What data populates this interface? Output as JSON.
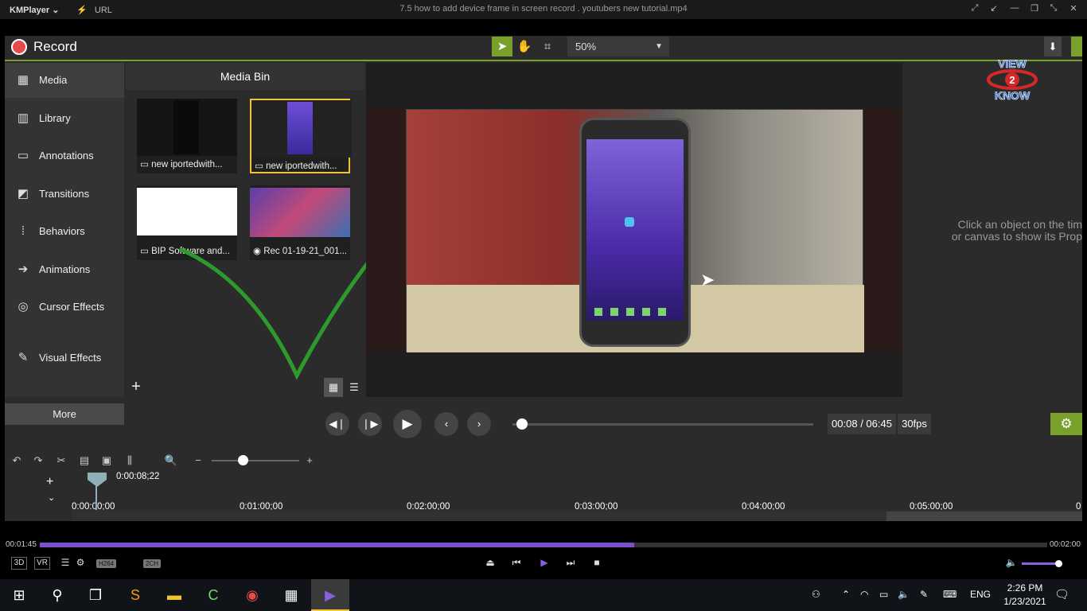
{
  "kmplayer": {
    "logo": "KMPlayer",
    "logo_dropdown": "⌄",
    "url_label": "URL",
    "window_title": "7.5 how to add device frame in screen record . youtubers new tutorial.mp4",
    "controls": [
      "pin-icon",
      "shrink-icon",
      "minimize-icon",
      "restore-icon",
      "fullscreen-icon",
      "close-icon"
    ],
    "elapsed": "00:01:45",
    "total": "00:02:00",
    "progress": 0.59,
    "volume": 0.92,
    "tags": [
      "H264",
      "2CH"
    ],
    "left_tools": [
      "3D",
      "VR"
    ]
  },
  "camtasia": {
    "record_label": "Record",
    "zoom_value": "50%",
    "nav": [
      {
        "label": "Media",
        "icon": "media-icon"
      },
      {
        "label": "Library",
        "icon": "library-icon"
      },
      {
        "label": "Annotations",
        "icon": "annotations-icon"
      },
      {
        "label": "Transitions",
        "icon": "transitions-icon"
      },
      {
        "label": "Behaviors",
        "icon": "behaviors-icon"
      },
      {
        "label": "Animations",
        "icon": "animations-icon"
      },
      {
        "label": "Cursor Effects",
        "icon": "cursor-effects-icon"
      },
      {
        "label": "Visual Effects",
        "icon": "visual-effects-icon"
      }
    ],
    "more_label": "More",
    "media_bin": {
      "title": "Media Bin",
      "items": [
        {
          "caption": "new iportedwith...",
          "kind": "video"
        },
        {
          "caption": "new iportedwith...",
          "kind": "video"
        },
        {
          "caption": "BIP Software and...",
          "kind": "video"
        },
        {
          "caption": "Rec 01-19-21_001...",
          "kind": "recording"
        }
      ]
    },
    "properties_hint_1": "Click an object on the tim",
    "properties_hint_2": "or canvas to show its Prop",
    "time_display": "00:08 / 06:45",
    "fps": "30fps",
    "playhead_time": "0:00:08;22",
    "ruler_ticks": [
      "0:00:00;00",
      "0:01:00;00",
      "0:02:00;00",
      "0:03:00;00",
      "0:04:00;00",
      "0:05:00;00",
      "0"
    ]
  },
  "watermark": {
    "line1": "VIEW",
    "digit": "2",
    "line2": "KNOW"
  },
  "taskbar": {
    "time": "2:26 PM",
    "date": "1/23/2021",
    "language": "ENG"
  },
  "colors": {
    "accent_green": "#7aa02c",
    "record_red": "#e54b4b",
    "selection_yellow": "#f1c232",
    "km_purple": "#7b4fc9"
  }
}
